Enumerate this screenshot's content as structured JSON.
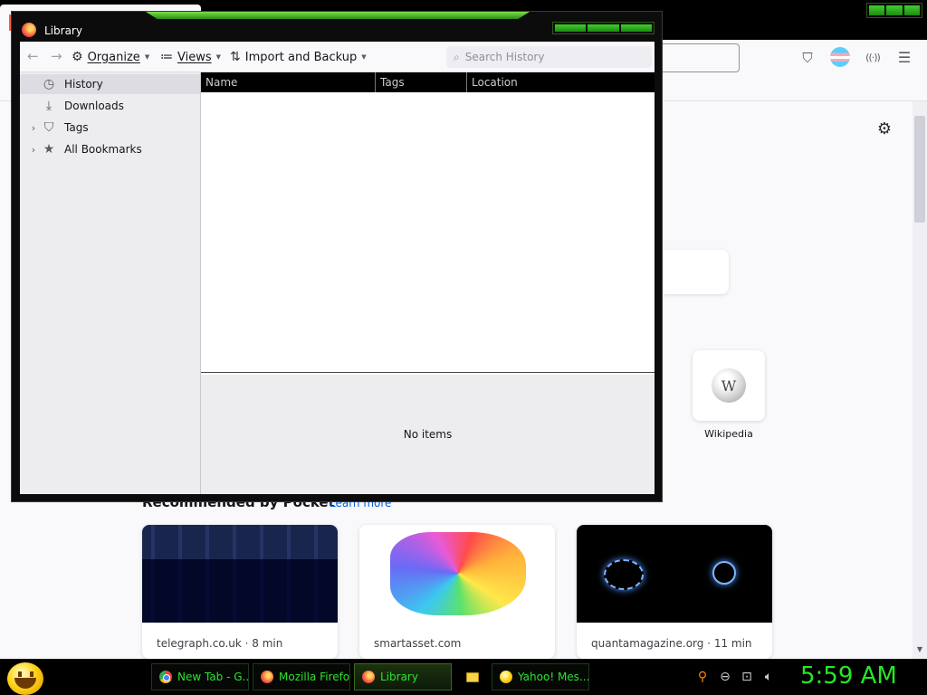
{
  "background_browser": {
    "settings_icon": "gear-icon",
    "toolbar_icons": [
      "pocket-icon",
      "account-icon",
      "extensions-icon",
      "menu-icon"
    ],
    "top_site": {
      "label": "Wikipedia",
      "icon": "wikipedia-globe-icon"
    },
    "pocket": {
      "heading": "Recommended by Pocket",
      "learn_more": "Learn more",
      "cards": [
        {
          "source": "telegraph.co.uk · 8 min"
        },
        {
          "source": "smartasset.com"
        },
        {
          "source": "quantamagazine.org · 11 min"
        }
      ]
    }
  },
  "library": {
    "title": "Library",
    "toolbar": {
      "organize": "Organize",
      "views": "Views",
      "import_backup": "Import and Backup",
      "search_placeholder": "Search History"
    },
    "sidebar": [
      {
        "label": "History",
        "icon": "clock-icon",
        "expandable": false,
        "selected": true
      },
      {
        "label": "Downloads",
        "icon": "download-icon",
        "expandable": false,
        "selected": false
      },
      {
        "label": "Tags",
        "icon": "tag-icon",
        "expandable": true,
        "selected": false
      },
      {
        "label": "All Bookmarks",
        "icon": "star-icon",
        "expandable": true,
        "selected": false
      }
    ],
    "columns": [
      "Name",
      "Tags",
      "Location"
    ],
    "details_text": "No items"
  },
  "taskbar": {
    "tasks": [
      {
        "label": "New Tab - G...",
        "icon": "chrome-icon",
        "active": false
      },
      {
        "label": "Mozilla Firefox",
        "icon": "firefox-icon",
        "active": false
      },
      {
        "label": "Library",
        "icon": "firefox-icon",
        "active": true
      },
      {
        "label": "Yahoo! Mes...",
        "icon": "yahoo-messenger-icon",
        "active": false
      }
    ],
    "clock": "5:59 AM"
  },
  "colors": {
    "accent_green": "#27e627",
    "titlebar": "#000000",
    "link_blue": "#0061e0"
  }
}
